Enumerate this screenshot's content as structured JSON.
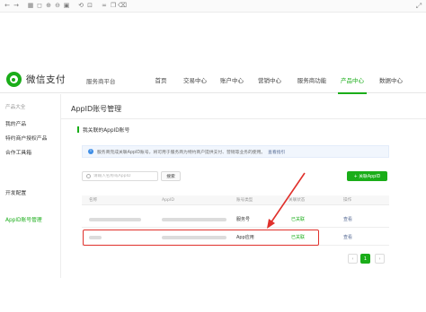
{
  "toolbar": {
    "icons": [
      "select-icon",
      "separator-icon",
      "thumbnail-icon",
      "zoom-out-icon",
      "zoom-in-icon",
      "fit-icon",
      "rotate-icon",
      "crop-icon",
      "link-icon",
      "copy-icon",
      "trash-icon",
      "expand-icon"
    ]
  },
  "header": {
    "brand": "微信支付",
    "platform": "服务商平台",
    "nav": [
      "首页",
      "交易中心",
      "账户中心",
      "营销中心",
      "服务商功能",
      "产品中心",
      "数据中心"
    ],
    "active_nav": "产品中心"
  },
  "sidebar": {
    "section": "产品大全",
    "items": [
      "我的产品",
      "特约商户授权产品",
      "合作工具箱",
      "开发配置",
      "AppID账号管理"
    ],
    "active_item": "AppID账号管理"
  },
  "main": {
    "title": "AppID账号管理",
    "panel_title": "我关联的AppID账号",
    "notice": "服务商完成关联AppID账号，将可用于服务商为特约商户提供支付、营销等业务的使用。",
    "notice_link": "查看指引",
    "search_placeholder": "请输入名称或AppID",
    "search_button": "搜索",
    "associate_button": "+ 关联AppID",
    "columns": [
      "名称",
      "AppID",
      "账号类型",
      "关联状态",
      "操作"
    ],
    "rows": [
      {
        "type": "服务号",
        "status": "已关联",
        "action": "查看"
      },
      {
        "type": "App应用",
        "status": "已关联",
        "action": "查看"
      }
    ],
    "pagination": {
      "prev": "‹",
      "current": "1",
      "next": "›"
    }
  },
  "colors": {
    "brand_green": "#1aad19",
    "link_blue": "#576b95",
    "annotation_red": "#e0302b"
  }
}
